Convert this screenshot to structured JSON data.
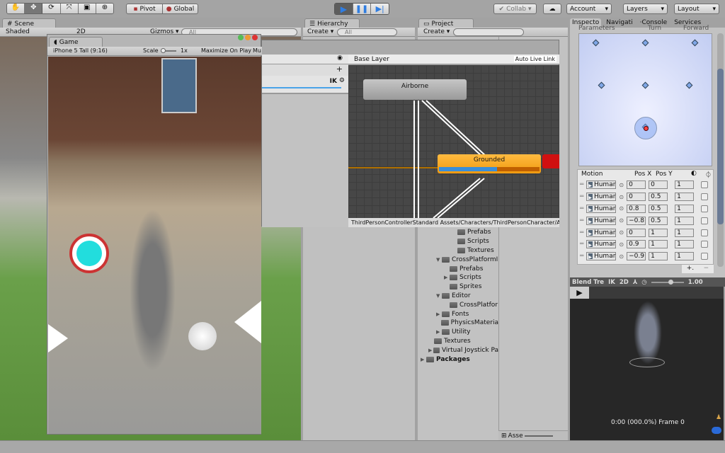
{
  "toolbar": {
    "tools": [
      "hand-tool",
      "move-tool",
      "rotate-tool",
      "scale-tool",
      "rect-tool",
      "transform-tool"
    ],
    "pivot": "Pivot",
    "global": "Global",
    "collab": "Collab ▾",
    "account": "Account",
    "layers": "Layers",
    "layout": "Layout"
  },
  "scene": {
    "tab": "Scene",
    "shading": "Shaded",
    "mode_2d": "2D",
    "gizmos": "Gizmos ▾",
    "search_placeholder": "All"
  },
  "game": {
    "tab": "Game",
    "aspect": "iPhone 5 Tall (9:16)",
    "scale_label": "Scale",
    "scale_value": "1x",
    "maximize": "Maximize On Play",
    "mute": "Mu"
  },
  "hierarchy": {
    "tab": "Hierarchy",
    "create": "Create ▾",
    "search_placeholder": "All"
  },
  "project": {
    "tab": "Project",
    "create": "Create ▾",
    "search_placeholder": "",
    "bottom_label": "Asse",
    "tree": [
      {
        "label": "Prefabs",
        "depth": 4,
        "arrow": ""
      },
      {
        "label": "Scripts",
        "depth": 4,
        "arrow": ""
      },
      {
        "label": "Textures",
        "depth": 4,
        "arrow": ""
      },
      {
        "label": "CrossPlatformI",
        "depth": 2,
        "arrow": "▼"
      },
      {
        "label": "Prefabs",
        "depth": 3,
        "arrow": ""
      },
      {
        "label": "Scripts",
        "depth": 3,
        "arrow": "▶"
      },
      {
        "label": "Sprites",
        "depth": 3,
        "arrow": ""
      },
      {
        "label": "Editor",
        "depth": 2,
        "arrow": "▼"
      },
      {
        "label": "CrossPlatfor",
        "depth": 3,
        "arrow": ""
      },
      {
        "label": "Fonts",
        "depth": 2,
        "arrow": "▶"
      },
      {
        "label": "PhysicsMateria",
        "depth": 2,
        "arrow": ""
      },
      {
        "label": "Utility",
        "depth": 2,
        "arrow": "▶"
      },
      {
        "label": "Textures",
        "depth": 1,
        "arrow": ""
      },
      {
        "label": "Virtual Joystick Pa",
        "depth": 1,
        "arrow": "▶"
      },
      {
        "label": "Packages",
        "depth": 0,
        "arrow": "▶",
        "bold": true
      }
    ]
  },
  "animator": {
    "breadcrumb": "Base Layer",
    "auto_live_link": "Auto Live Link",
    "layer_ik": "IK",
    "states": {
      "airborne": "Airborne",
      "grounded": "Grounded"
    },
    "grounded_progress": 0.58,
    "path": "ThirdPersonControllerStandard Assets/Characters/ThirdPersonCharacter/Animat"
  },
  "inspector": {
    "tabs": [
      "Inspecto",
      "Navigati",
      "·Console",
      "Services"
    ],
    "params_label": "Parameters",
    "param_x": "Turn",
    "param_y": "Forward",
    "headers": {
      "motion": "Motion",
      "posx": "Pos X",
      "posy": "Pos Y"
    },
    "motions": [
      {
        "clip": "Humar",
        "x": "0",
        "y": "0",
        "speed": "1"
      },
      {
        "clip": "Humar",
        "x": "0",
        "y": "0.5",
        "speed": "1"
      },
      {
        "clip": "Humar",
        "x": "0.8",
        "y": "0.5",
        "speed": "1"
      },
      {
        "clip": "Humar",
        "x": "−0.8",
        "y": "0.5",
        "speed": "1"
      },
      {
        "clip": "Humar",
        "x": "0",
        "y": "1",
        "speed": "1"
      },
      {
        "clip": "Humar",
        "x": "0.9",
        "y": "1",
        "speed": "1"
      },
      {
        "clip": "Humar",
        "x": "−0.9",
        "y": "1",
        "speed": "1"
      }
    ],
    "add": "+.",
    "remove": "−"
  },
  "preview": {
    "title": "Blend Tre",
    "ik": "IK",
    "mode_2d": "2D",
    "speed": "1.00",
    "time": "0:00 (000.0%) Frame 0"
  },
  "colors": {
    "play_active": "#2f7de1",
    "grounded": "#f5a623",
    "progress": "#3a8ed8",
    "blend_bg": "#cdd6f5"
  }
}
